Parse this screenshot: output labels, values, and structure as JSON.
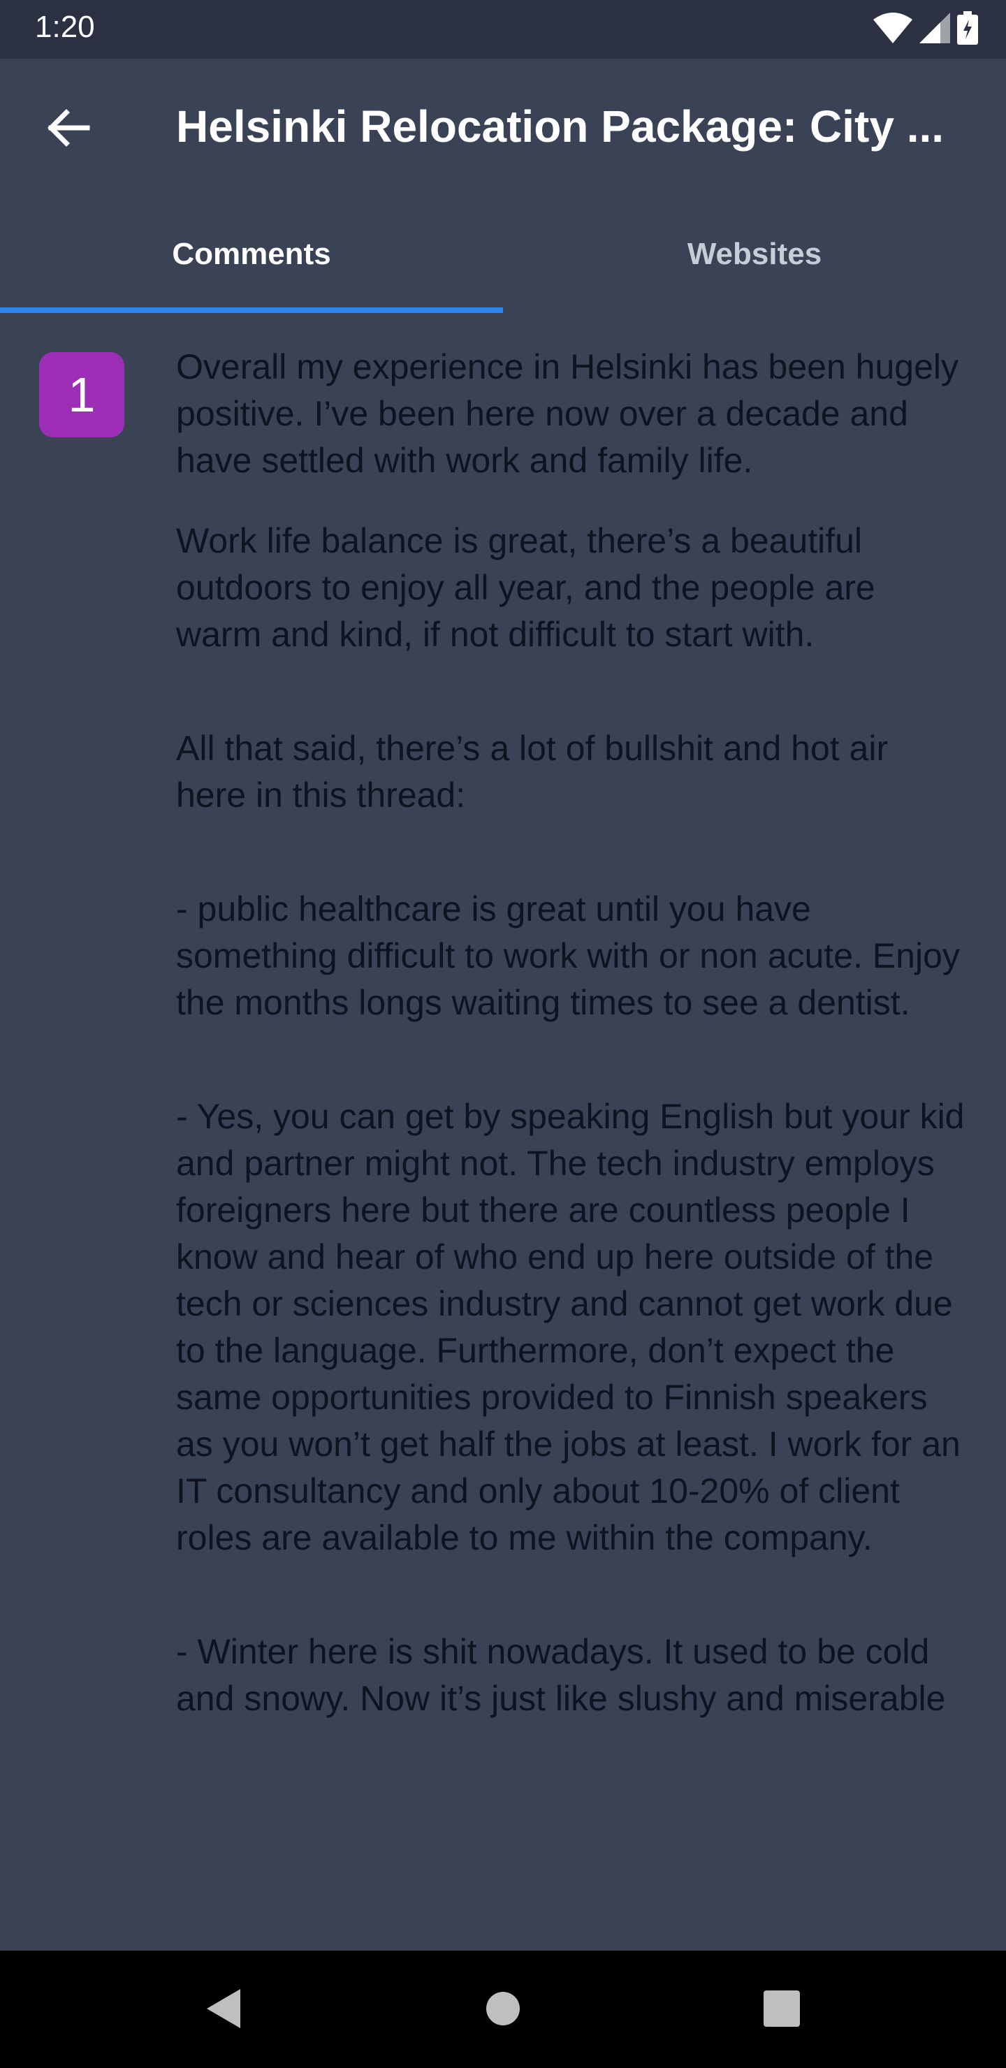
{
  "status_bar": {
    "time": "1:20"
  },
  "app_bar": {
    "title": "Helsinki Relocation Package: City ..."
  },
  "tabs": [
    {
      "label": "Comments",
      "selected": true
    },
    {
      "label": "Websites",
      "selected": false
    }
  ],
  "comment": {
    "number": "1",
    "paragraphs": [
      "Overall my experience in Helsinki has been hugely positive. I’ve been here now over a decade and have settled with work and family life.",
      "Work life balance is great, there’s a beautiful outdoors to enjoy all year, and the people are warm and kind, if not difficult to start with.",
      "All that said, there’s a lot of bullshit and hot air here in this thread:",
      "- public healthcare is great until you have something difficult to work with or non acute. Enjoy the months longs waiting times to see a dentist.",
      "- Yes, you can get by speaking English but your kid and partner might not. The tech industry employs foreigners here but there are countless people I know and hear of who end up here outside of the tech or sciences industry and cannot get work due to the language. Furthermore, don’t expect the same opportunities provided to Finnish speakers as you won’t get half the jobs at least. I work for an IT consultancy and only about 10-20% of client roles are available to me within the company.",
      "- Winter here is shit nowadays. It used to be cold and snowy. Now it’s just like slushy and miserable"
    ]
  },
  "colors": {
    "background": "#3a4256",
    "status_bar": "#2b3142",
    "tab_indicator": "#2b86e8",
    "badge": "#9c2fb5",
    "comment_text": "#0f1320"
  },
  "icons": {
    "back": "arrow-left-icon",
    "wifi": "wifi-icon",
    "signal": "signal-icon",
    "battery": "battery-icon",
    "nav_back": "triangle-back-icon",
    "nav_home": "circle-home-icon",
    "nav_recents": "square-recents-icon"
  }
}
